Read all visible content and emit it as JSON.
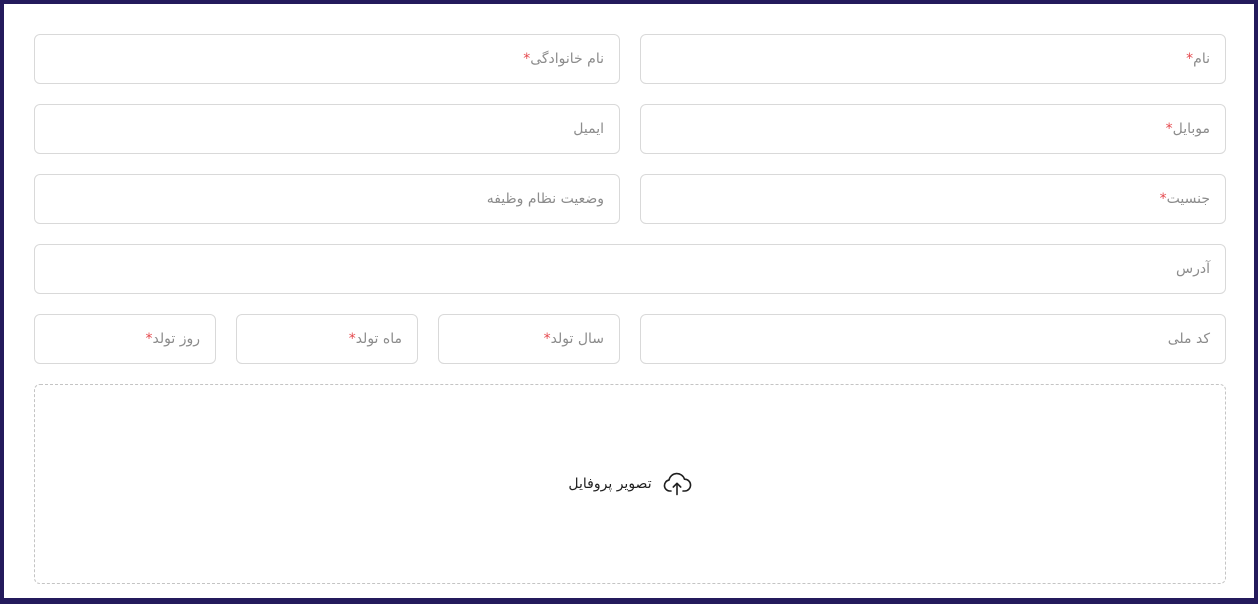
{
  "form": {
    "first_name": {
      "placeholder": "نام",
      "required_mark": "*"
    },
    "last_name": {
      "placeholder": "نام خانوادگی",
      "required_mark": "*"
    },
    "mobile": {
      "placeholder": "موبایل",
      "required_mark": "*"
    },
    "email": {
      "placeholder": "ایمیل"
    },
    "gender": {
      "placeholder": "جنسیت",
      "required_mark": "*"
    },
    "military_status": {
      "placeholder": "وضعیت نظام وظیفه"
    },
    "address": {
      "placeholder": "آدرس"
    },
    "national_code": {
      "placeholder": "کد ملی"
    },
    "birth_year": {
      "placeholder": "سال تولد",
      "required_mark": "*"
    },
    "birth_month": {
      "placeholder": "ماه تولد",
      "required_mark": "*"
    },
    "birth_day": {
      "placeholder": "روز تولد",
      "required_mark": "*"
    }
  },
  "upload": {
    "label": "تصویر پروفایل",
    "icon": "cloud-upload-icon"
  },
  "colors": {
    "frame_border": "#241a5c",
    "required": "#e5484d",
    "placeholder": "#8c8c8c",
    "field_border": "#d9d9d9"
  }
}
